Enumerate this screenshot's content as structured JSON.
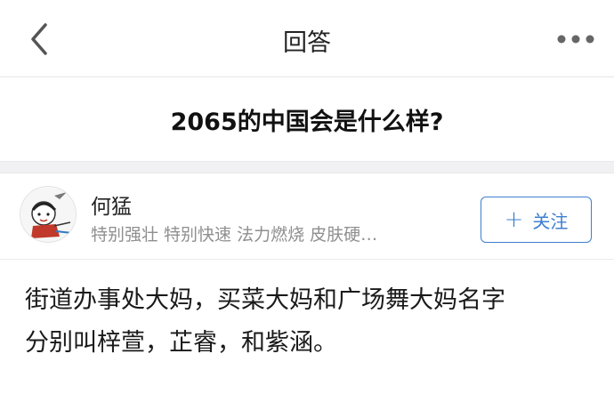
{
  "header": {
    "title": "回答",
    "back_icon": "chevron-left-icon",
    "more_icon": "more-horizontal-icon"
  },
  "question": {
    "title": "2065的中国会是什么样?"
  },
  "author": {
    "name": "何猛",
    "bio": "特别强壮 特别快速 法力燃烧 皮肤硬…",
    "follow_label": "关注",
    "follow_icon": "plus-icon",
    "accent_color": "#3e7fcf"
  },
  "answer": {
    "lines": [
      "街道办事处大妈，买菜大妈和广场舞大妈名字",
      "分别叫梓萱，芷睿，和紫涵。"
    ]
  }
}
